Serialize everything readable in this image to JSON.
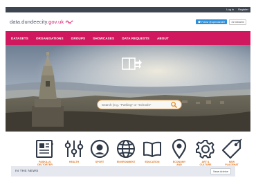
{
  "topbar": {
    "login": "Log in",
    "register": "Register"
  },
  "header": {
    "brand_prefix": "data.dundeecity",
    "brand_suffix": ".gov.uk",
    "twitter_label": "Follow @opendundee",
    "followers": "31 followers"
  },
  "nav": {
    "items": [
      {
        "label": "DATASETS"
      },
      {
        "label": "ORGANISATIONS"
      },
      {
        "label": "GROUPS"
      },
      {
        "label": "SHOWCASES"
      },
      {
        "label": "DATA REQUESTS"
      },
      {
        "label": "ABOUT"
      }
    ]
  },
  "hero": {
    "search_placeholder": "Search (e.g. \"Parking\" or \"Schools\"",
    "icons": {
      "hero": "share-icon",
      "search": "search-icon"
    }
  },
  "categories": [
    {
      "label": "PASKILLU\nDELTORTER",
      "icon": "newspaper-icon"
    },
    {
      "label": "HEALTH",
      "icon": "sliders-icon"
    },
    {
      "label": "SPORT",
      "icon": "football-icon"
    },
    {
      "label": "ENVIRONMENT",
      "icon": "globe-icon"
    },
    {
      "label": "EDUCATION",
      "icon": "book-icon"
    },
    {
      "label": "ECONOMY\nAND\nFINANCE",
      "icon": "location-pin-icon"
    },
    {
      "label": "ART &\nCULTURE",
      "icon": "gear-icon"
    },
    {
      "label": "NEW\nPLACEHAT\nMAH",
      "icon": "tag-icon"
    }
  ],
  "news": {
    "title": "IN THE NEWS",
    "archive_label": "News Archive"
  },
  "colors": {
    "brand": "#d0185e",
    "accent": "#e0731b",
    "topbar": "#3d4550",
    "twitter": "#2d8fd8"
  }
}
